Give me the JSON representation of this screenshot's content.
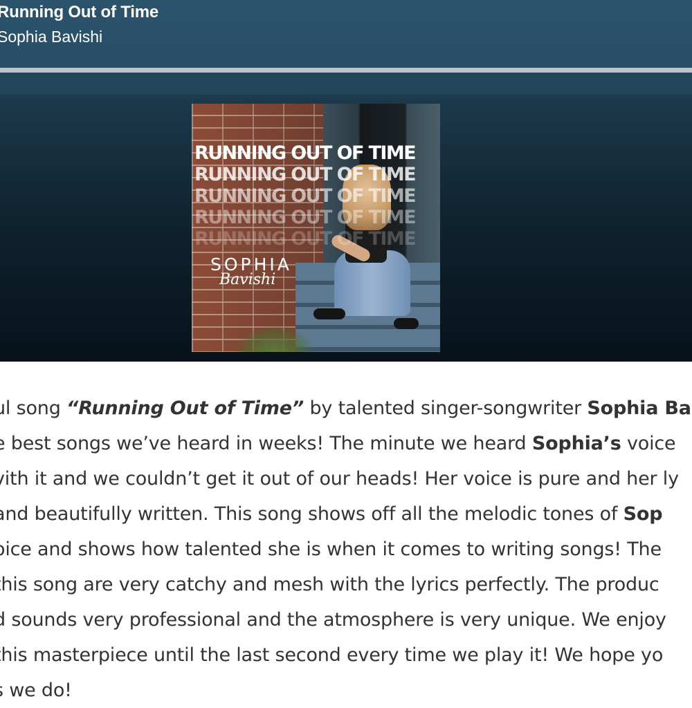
{
  "player": {
    "track_title": "Running Out of Time",
    "artist": "Sophia Bavishi",
    "progress_fraction": 1.0,
    "cover": {
      "title_rows": [
        "RUNNING OUT OF TIME",
        "RUNNING OUT OF TIME",
        "RUNNING OUT OF TIME",
        "RUNNING OUT OF TIME",
        "RUNNING OUT OF TIME"
      ],
      "logo_top": "SOPHIA",
      "logo_script": "Bavishi"
    }
  },
  "article": {
    "line1": {
      "pre": "ul song ",
      "song": "“Running Out of Time”",
      "mid": " by talented singer-songwriter ",
      "bold": "Sophia Ba"
    },
    "line2": {
      "pre": "e best songs we’ve heard in weeks! The minute we heard ",
      "bold": "Sophia’s",
      "post": " voice"
    },
    "line3": "vith it and we couldn’t get it out of our heads! Her voice is pure and her ly",
    "line4": {
      "pre": "and beautifully written. This song shows off all the melodic tones of ",
      "bold": "Sop"
    },
    "line5": "oice and shows how talented she is when it comes to writing songs! The",
    "line6": " this song are very catchy and mesh with the lyrics perfectly. The produc",
    "line7": "d sounds very professional and the atmosphere is very unique. We enjoy",
    "line8": "this masterpiece until the last second every time we play it! We hope yo",
    "line9": "s we do!"
  }
}
